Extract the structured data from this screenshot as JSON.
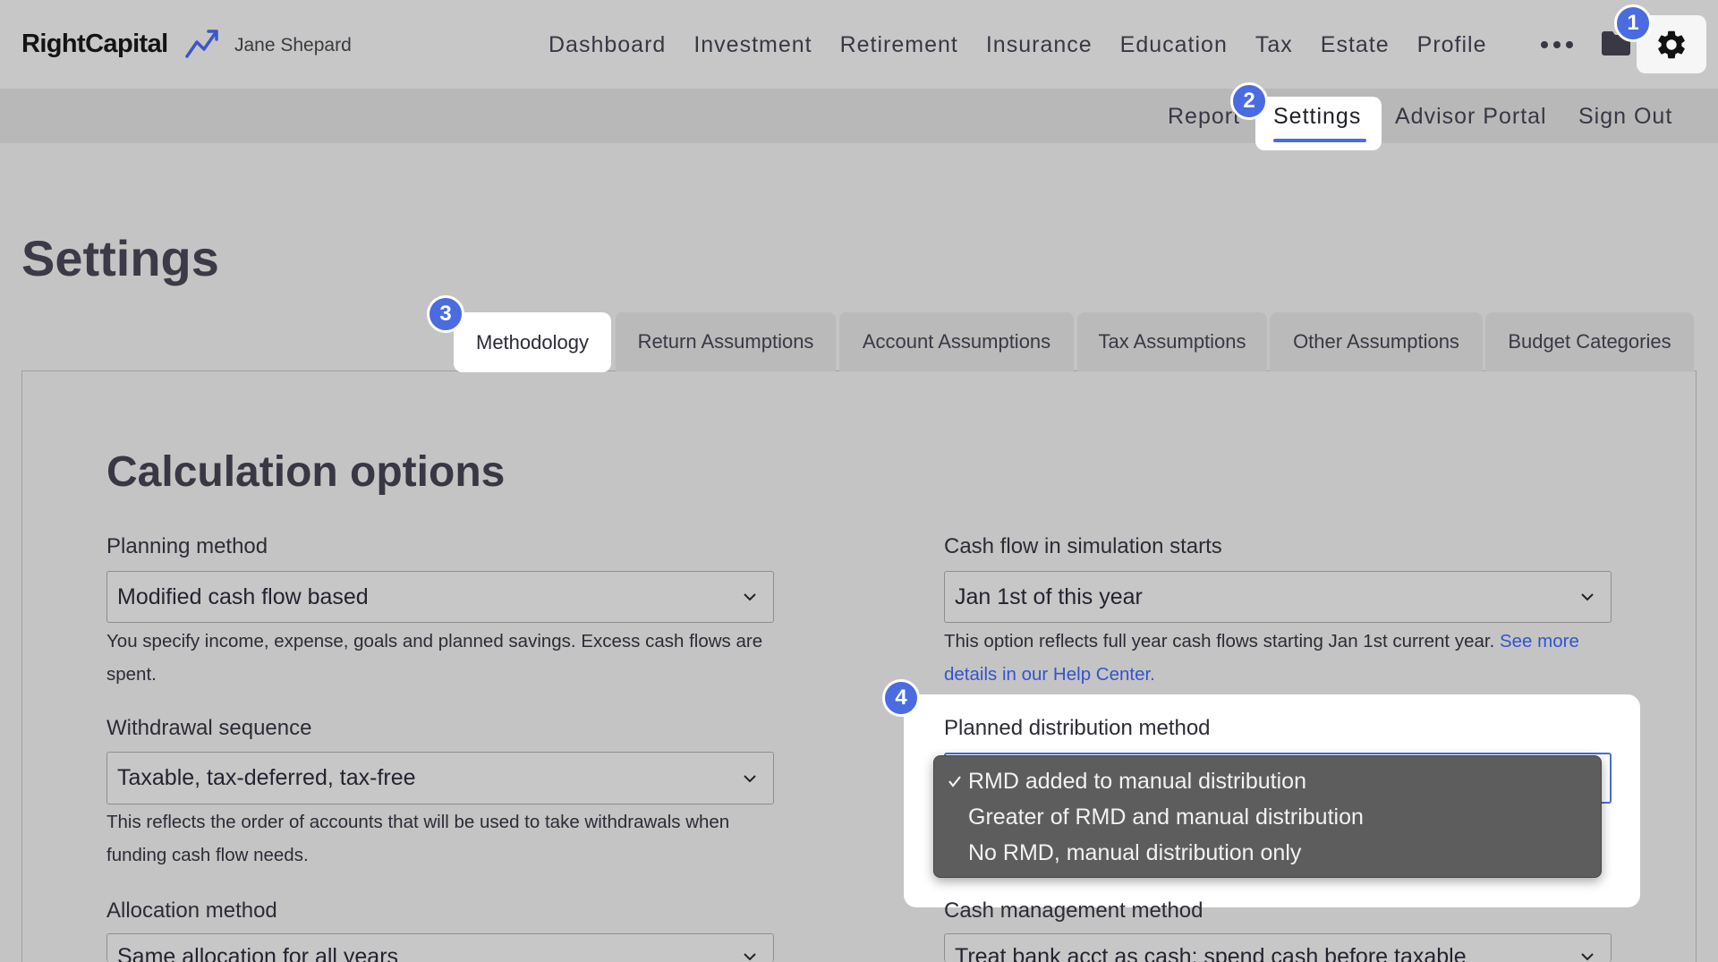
{
  "header": {
    "logo_text": "RightCapital",
    "client_name": "Jane Shepard",
    "nav": [
      "Dashboard",
      "Investment",
      "Retirement",
      "Insurance",
      "Education",
      "Tax",
      "Estate",
      "Profile"
    ],
    "icons": {
      "logo_mark": "trend-arrow-icon",
      "more": "more-icon",
      "folder": "folder-icon",
      "settings": "gear-icon"
    }
  },
  "subnav": {
    "items": [
      "Report",
      "Settings",
      "Advisor Portal",
      "Sign Out"
    ],
    "active_index": 1
  },
  "tutorial_steps": [
    "1",
    "2",
    "3",
    "4"
  ],
  "page_title": "Settings",
  "tabs": [
    "Methodology",
    "Return Assumptions",
    "Account Assumptions",
    "Tax Assumptions",
    "Other Assumptions",
    "Budget Categories"
  ],
  "active_tab_index": 0,
  "section_title": "Calculation options",
  "fields": {
    "planning_method": {
      "label": "Planning method",
      "value": "Modified cash flow based",
      "help": "You specify income, expense, goals and planned savings. Excess cash flows are spent."
    },
    "withdrawal_sequence": {
      "label": "Withdrawal sequence",
      "value": "Taxable, tax-deferred, tax-free",
      "help": "This reflects the order of accounts that will be used to take withdrawals when funding cash flow needs."
    },
    "allocation_method": {
      "label": "Allocation method",
      "value": "Same allocation for all years"
    },
    "cash_flow_start": {
      "label": "Cash flow in simulation starts",
      "value": "Jan 1st of this year",
      "help": "This option reflects full year cash flows starting Jan 1st current year.",
      "help_link": "See more details in our Help Center."
    },
    "planned_distribution": {
      "label": "Planned distribution method",
      "open": true,
      "selected_index": 0,
      "options": [
        "RMD added to manual distribution",
        "Greater of RMD and manual distribution",
        "No RMD, manual distribution only"
      ]
    },
    "cash_management": {
      "label": "Cash management method",
      "value": "Treat bank acct as cash; spend cash before taxable"
    }
  },
  "colors": {
    "accent": "#4a6ce0",
    "link": "#3454cc",
    "dimmed_background": "#c4c4c4",
    "highlight": "#ffffff",
    "dropdown_background": "#5d5d5d"
  }
}
